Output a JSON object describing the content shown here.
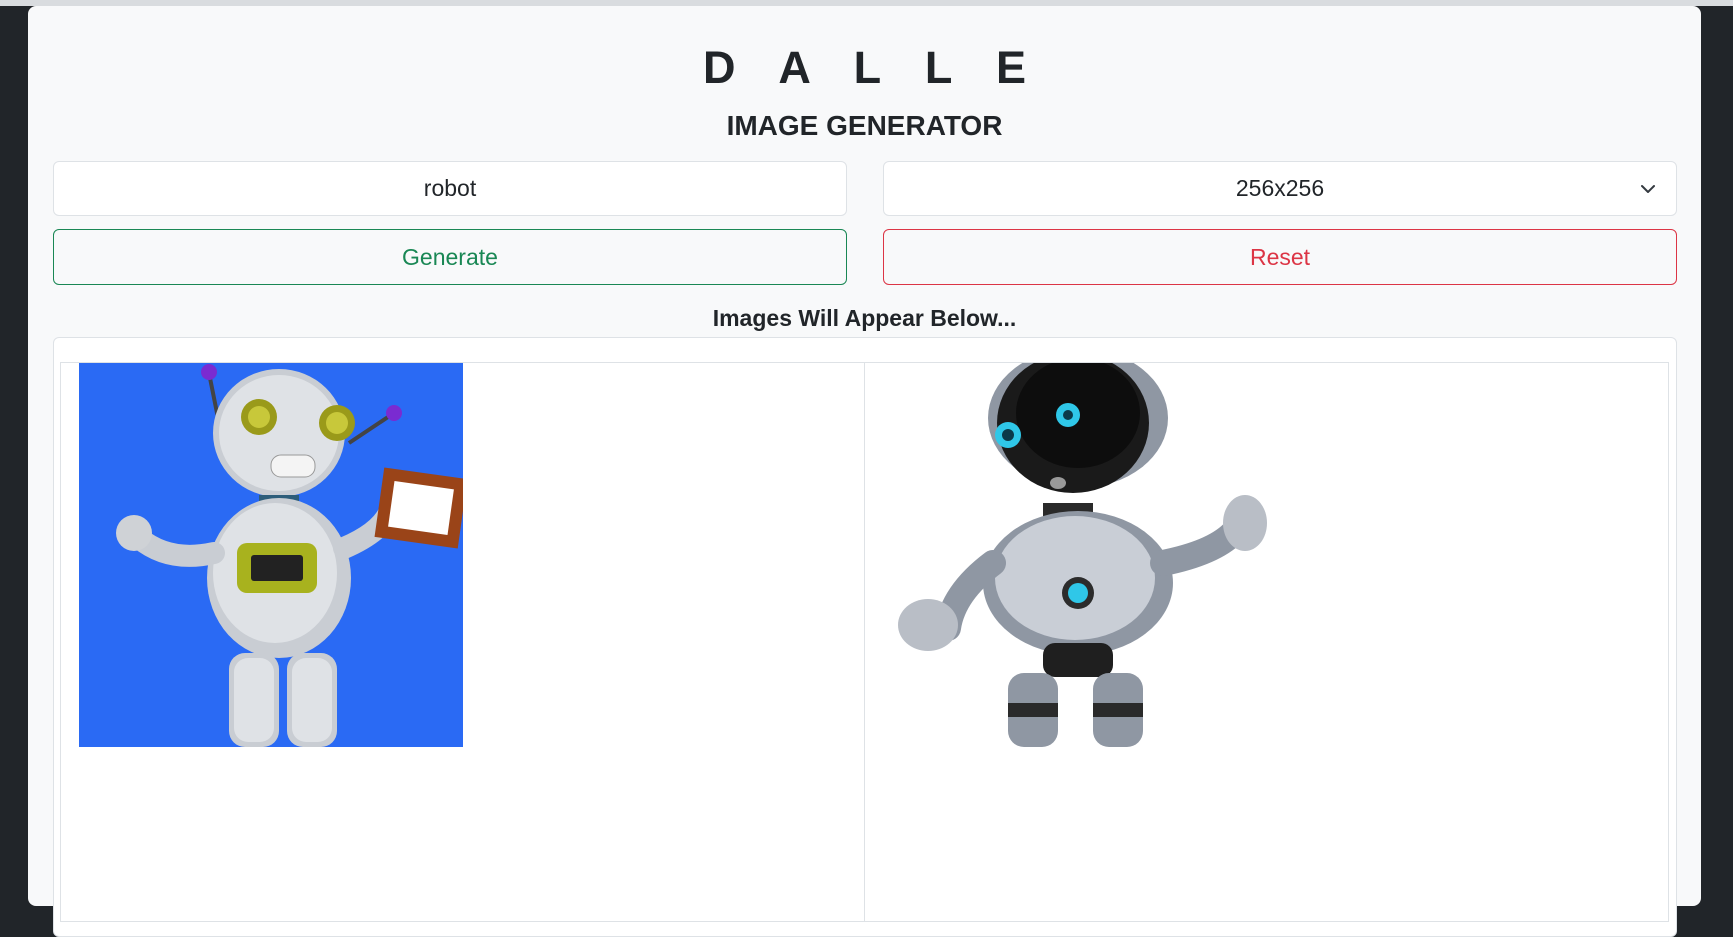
{
  "app": {
    "title": "D A L L E",
    "subtitle": "IMAGE GENERATOR"
  },
  "form": {
    "prompt_value": "robot",
    "size_value": "256x256",
    "size_options": [
      "256x256"
    ],
    "generate_label": "Generate",
    "reset_label": "Reset"
  },
  "results": {
    "hint": "Images Will Appear Below...",
    "images": [
      {
        "name": "robot-image-1",
        "description_icon": "robot-illustration-blue-background"
      },
      {
        "name": "robot-image-2",
        "description_icon": "robot-illustration-white-background"
      }
    ]
  },
  "colors": {
    "generate": "#198754",
    "reset": "#dc3545",
    "page_bg": "#212529",
    "card_bg": "#f8f9fa",
    "image1_bg": "#2a6af4"
  }
}
